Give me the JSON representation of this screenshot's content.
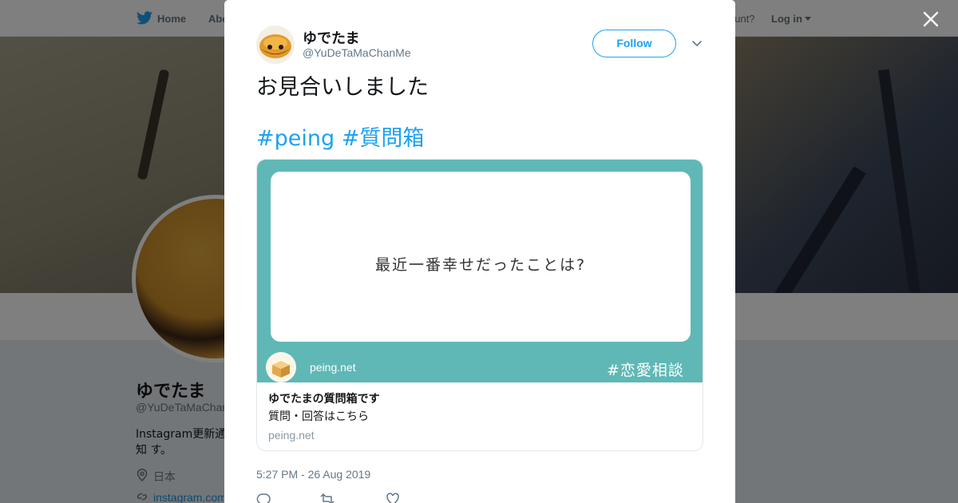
{
  "background": {
    "nav": {
      "home_label": "Home",
      "about_label": "Abo",
      "account_prompt": "ccount?",
      "login_label": "Log in"
    },
    "profile": {
      "name": "ゆでたま",
      "handle": "@YuDeTaMaChan",
      "bio": "Instagram更新通知 す。",
      "location": "日本",
      "link": "instagram.com"
    }
  },
  "tweet": {
    "user": {
      "display_name": "ゆでたま",
      "screen_name": "@YuDeTaMaChanMe"
    },
    "follow_label": "Follow",
    "text": "お見合いしました",
    "hashtags": [
      "#peing",
      "#質問箱"
    ],
    "card": {
      "image_question": "最近一番幸せだったことは?",
      "image_domain": "peing.net",
      "image_tag": "#恋愛相談",
      "title": "ゆでたまの質問箱です",
      "description": "質問・回答はこちら",
      "url": "peing.net"
    },
    "timestamp": "5:27 PM - 26 Aug 2019"
  },
  "icons": {
    "twitter_bird": "twitter-bird-icon",
    "close": "close-icon",
    "chevron": "chevron-down-icon",
    "reply": "reply-icon",
    "retweet": "retweet-icon",
    "like": "heart-icon",
    "location": "location-pin-icon",
    "link": "link-icon"
  },
  "colors": {
    "accent": "#1da1f2",
    "card_teal": "#5fb8b6",
    "text_primary": "#14171a",
    "text_secondary": "#657786"
  }
}
